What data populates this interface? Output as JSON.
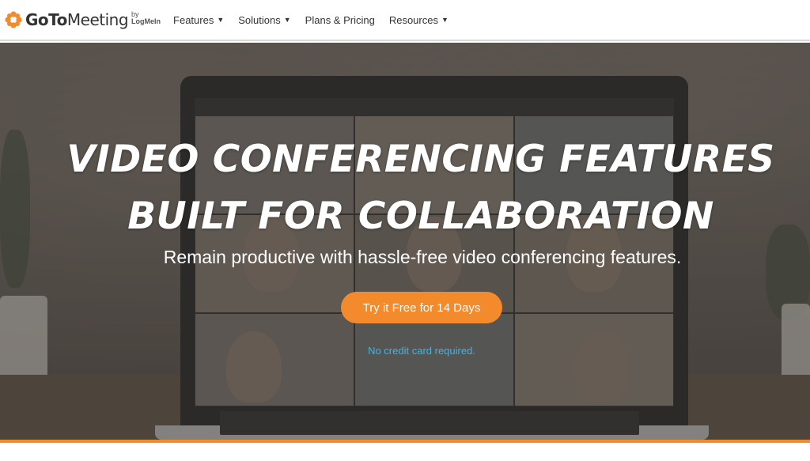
{
  "header": {
    "logo": {
      "brand_goto": "GoTo",
      "brand_meeting": "Meeting",
      "by": "by",
      "logmein": "LogMeIn"
    },
    "nav": [
      {
        "label": "Features",
        "has_dropdown": true
      },
      {
        "label": "Solutions",
        "has_dropdown": true
      },
      {
        "label": "Plans & Pricing",
        "has_dropdown": false
      },
      {
        "label": "Resources",
        "has_dropdown": true
      }
    ]
  },
  "hero": {
    "title_line1": "VIDEO CONFERENCING FEATURES",
    "title_line2": "BUILT FOR COLLABORATION",
    "subtitle": "Remain productive with hassle-free video conferencing features.",
    "cta_label": "Try it Free for 14 Days",
    "note": "No credit card required."
  },
  "colors": {
    "accent": "#f38a2c",
    "link": "#3fb6e4",
    "logo_orange": "#f38a2c"
  },
  "icons": {
    "logo": "flower-logo-icon",
    "caret": "chevron-down-icon"
  }
}
